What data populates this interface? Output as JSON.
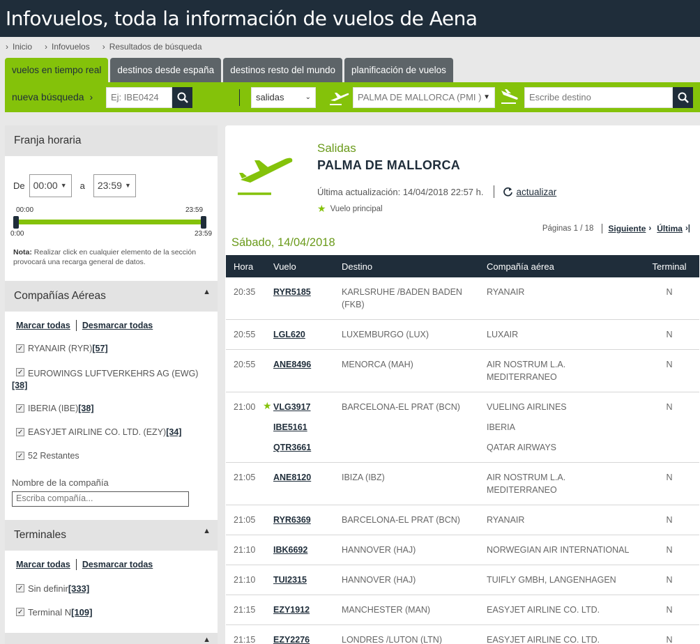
{
  "header": {
    "title": "Infovuelos, toda la información de vuelos de Aena"
  },
  "breadcrumb": [
    "Inicio",
    "Infovuelos",
    "Resultados de búsqueda"
  ],
  "tabs": [
    {
      "label": "vuelos en tiempo real",
      "active": true
    },
    {
      "label": "destinos desde españa",
      "active": false
    },
    {
      "label": "destinos resto del mundo",
      "active": false
    },
    {
      "label": "planificación de vuelos",
      "active": false
    }
  ],
  "search": {
    "label": "nueva búsqueda",
    "flight_placeholder": "Ej: IBE0424",
    "direction": "salidas",
    "origin": "PALMA DE MALLORCA (PMI )",
    "destination_placeholder": "Escribe destino"
  },
  "filters": {
    "time": {
      "title": "Franja horaria",
      "from_label": "De",
      "from_value": "00:00",
      "to_label": "a",
      "to_value": "23:59",
      "slider_top_min": "00:00",
      "slider_top_max": "23:59",
      "slider_bottom_min": "0:00",
      "slider_bottom_max": "23:59",
      "note_bold": "Nota:",
      "note_text": " Realizar click en cualquier elemento de la sección provocará una recarga general de datos."
    },
    "airlines": {
      "title": "Compañías Aéreas",
      "mark_all": "Marcar todas",
      "unmark_all": "Desmarcar todas",
      "items": [
        {
          "label": "RYANAIR (RYR)",
          "count": "[57]"
        },
        {
          "label": "EUROWINGS LUFTVERKEHRS AG (EWG)",
          "count": "[38]"
        },
        {
          "label": "IBERIA (IBE)",
          "count": "[38]"
        },
        {
          "label": "EASYJET AIRLINE CO. LTD. (EZY)",
          "count": "[34]"
        },
        {
          "label": "52 Restantes",
          "count": ""
        }
      ],
      "name_label": "Nombre de la compañía",
      "name_placeholder": "Escriba compañía..."
    },
    "terminals": {
      "title": "Terminales",
      "mark_all": "Marcar todas",
      "unmark_all": "Desmarcar todas",
      "items": [
        {
          "label": "Sin definir",
          "count": "[333]"
        },
        {
          "label": "Terminal N",
          "count": "[109]"
        }
      ]
    }
  },
  "results": {
    "subtitle": "Salidas",
    "airport": "PALMA DE MALLORCA",
    "last_update": "Última actualización: 14/04/2018 22:57 h.",
    "refresh": "actualizar",
    "principal_label": "Vuelo principal",
    "pages": "Páginas 1 / 18",
    "next": "Siguiente",
    "last": "Última",
    "date": "Sábado, 14/04/2018",
    "columns": [
      "Hora",
      "Vuelo",
      "Destino",
      "Compañía aérea",
      "Terminal"
    ],
    "rows": [
      {
        "hora": "20:35",
        "vuelos": [
          "RYR5185"
        ],
        "destino": "KARLSRUHE /BADEN BADEN (FKB)",
        "companias": [
          "RYANAIR"
        ],
        "terminal": "N",
        "principal": false
      },
      {
        "hora": "20:55",
        "vuelos": [
          "LGL620"
        ],
        "destino": "LUXEMBURGO (LUX)",
        "companias": [
          "LUXAIR"
        ],
        "terminal": "N",
        "principal": false
      },
      {
        "hora": "20:55",
        "vuelos": [
          "ANE8496"
        ],
        "destino": "MENORCA (MAH)",
        "companias": [
          "AIR NOSTRUM L.A. MEDITERRANEO"
        ],
        "terminal": "N",
        "principal": false
      },
      {
        "hora": "21:00",
        "vuelos": [
          "VLG3917",
          "IBE5161",
          "QTR3661"
        ],
        "destino": "BARCELONA-EL PRAT (BCN)",
        "companias": [
          "VUELING AIRLINES",
          "IBERIA",
          "QATAR AIRWAYS"
        ],
        "terminal": "N",
        "principal": true
      },
      {
        "hora": "21:05",
        "vuelos": [
          "ANE8120"
        ],
        "destino": "IBIZA (IBZ)",
        "companias": [
          "AIR NOSTRUM L.A. MEDITERRANEO"
        ],
        "terminal": "N",
        "principal": false
      },
      {
        "hora": "21:05",
        "vuelos": [
          "RYR6369"
        ],
        "destino": "BARCELONA-EL PRAT (BCN)",
        "companias": [
          "RYANAIR"
        ],
        "terminal": "N",
        "principal": false
      },
      {
        "hora": "21:10",
        "vuelos": [
          "IBK6692"
        ],
        "destino": "HANNOVER (HAJ)",
        "companias": [
          "NORWEGIAN AIR INTERNATIONAL"
        ],
        "terminal": "N",
        "principal": false
      },
      {
        "hora": "21:10",
        "vuelos": [
          "TUI2315"
        ],
        "destino": "HANNOVER (HAJ)",
        "companias": [
          "TUIFLY GMBH, LANGENHAGEN"
        ],
        "terminal": "N",
        "principal": false
      },
      {
        "hora": "21:15",
        "vuelos": [
          "EZY1912"
        ],
        "destino": "MANCHESTER (MAN)",
        "companias": [
          "EASYJET AIRLINE CO. LTD."
        ],
        "terminal": "N",
        "principal": false
      },
      {
        "hora": "21:15",
        "vuelos": [
          "EZY2276"
        ],
        "destino": "LONDRES /LUTON (LTN)",
        "companias": [
          "EASYJET AIRLINE CO. LTD."
        ],
        "terminal": "N",
        "principal": false
      }
    ]
  },
  "colors": {
    "brand_dark": "#1f2d3a",
    "accent_green": "#84c20a",
    "title_green": "#6a9a1a"
  }
}
